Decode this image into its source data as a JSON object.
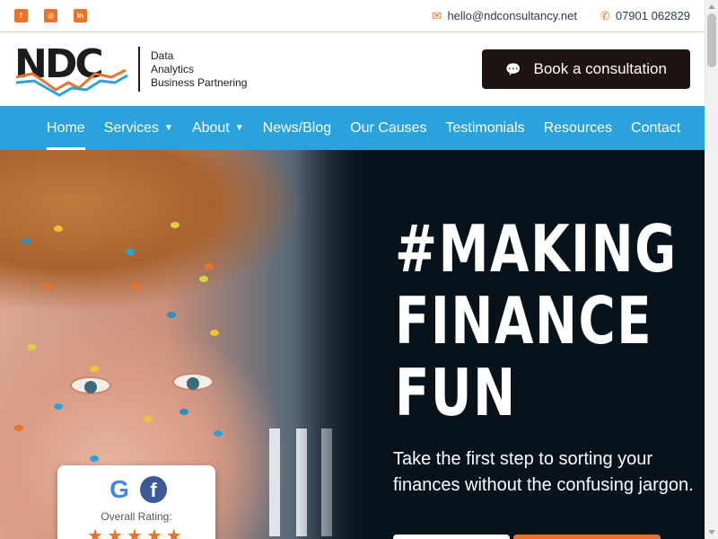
{
  "topbar": {
    "social": [
      {
        "name": "facebook-icon",
        "glyph": "f"
      },
      {
        "name": "instagram-icon",
        "glyph": "◎"
      },
      {
        "name": "linkedin-icon",
        "glyph": "in"
      }
    ],
    "email": "hello@ndconsultancy.net",
    "phone": "07901 062829"
  },
  "header": {
    "logo_letters": "NDC",
    "logo_lines": [
      "Data",
      "Analytics",
      "Business Partnering"
    ],
    "cta_label": "Book a consultation"
  },
  "nav": {
    "items": [
      {
        "label": "Home",
        "active": true,
        "dropdown": false
      },
      {
        "label": "Services",
        "active": false,
        "dropdown": true
      },
      {
        "label": "About",
        "active": false,
        "dropdown": true
      },
      {
        "label": "News/Blog",
        "active": false,
        "dropdown": false
      },
      {
        "label": "Our Causes",
        "active": false,
        "dropdown": false
      },
      {
        "label": "Testimonials",
        "active": false,
        "dropdown": false
      },
      {
        "label": "Resources",
        "active": false,
        "dropdown": false
      },
      {
        "label": "Contact",
        "active": false,
        "dropdown": false
      }
    ]
  },
  "hero": {
    "headline": [
      "#MAKING",
      "FINANCE",
      "FUN"
    ],
    "subtitle": "Take the first step to sorting your finances without the confusing jargon."
  },
  "rating": {
    "label": "Overall Rating:",
    "stars": "★★★★★",
    "google_glyph": "G",
    "facebook_glyph": "f"
  },
  "colors": {
    "accent_orange": "#e8742c",
    "nav_blue": "#2aa3dc",
    "cta_dark": "#1e1412",
    "hero_bg": "#07121a"
  }
}
